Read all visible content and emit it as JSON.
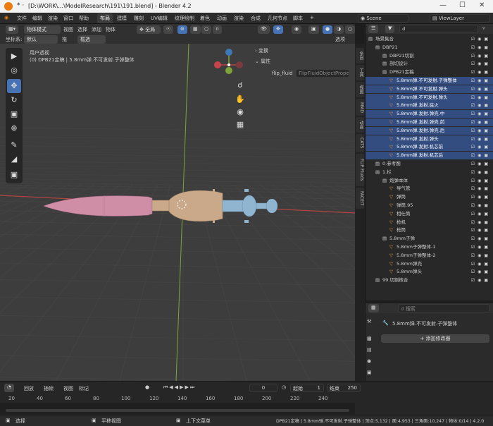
{
  "titlebar": {
    "title": "[D:\\WORK\\...\\ModelResearch\\191\\191.blend] - Blender 4.2"
  },
  "menubar": {
    "menus": [
      "文件",
      "编辑",
      "渲染",
      "窗口",
      "帮助"
    ],
    "workspaces": [
      "布局",
      "建模",
      "雕刻",
      "UV编辑",
      "纹理绘制",
      "着色",
      "动画",
      "渲染",
      "合成",
      "几何节点",
      "脚本"
    ],
    "scene": "Scene",
    "view_layer": "ViewLayer"
  },
  "vp_header": {
    "mode": "物体模式",
    "view": "视图",
    "select": "选择",
    "add": "添加",
    "object": "物体",
    "global": "全局",
    "coord_label": "坐标系:",
    "coord_value": "默认",
    "drag_label": "拖",
    "drag_value": "框选",
    "options": "选项"
  },
  "viewport": {
    "view_name": "用户透视",
    "info": "(0) DPB21定稿 | 5.8mm弹.不可发射.子弹整体",
    "panel_transform": "变换",
    "panel_props": "属性",
    "prop_key": "flip_fluid",
    "prop_value": "FlipFluidObjectProperti",
    "colors": {
      "bullet": "#cf8ea6",
      "case": "#c9a989",
      "fuse": "#8fb5d0",
      "grid": "#464646",
      "x_axis": "#b24444",
      "y_axis": "#7ea33a"
    }
  },
  "vtabs": [
    "条目",
    "工具",
    "视图",
    "MMD",
    "动画",
    "CATS",
    "FLIP Fluids",
    "FACEIT"
  ],
  "outliner": {
    "search_placeholder": "",
    "rows": [
      {
        "name": "场景集合",
        "indent": 0,
        "sel": false
      },
      {
        "name": "DBP21",
        "indent": 1,
        "sel": false
      },
      {
        "name": "DBP21切割",
        "indent": 2,
        "sel": false
      },
      {
        "name": "剖切设计",
        "indent": 2,
        "sel": false
      },
      {
        "name": "DPB21定稿",
        "indent": 2,
        "sel": false
      },
      {
        "name": "5.8mm弹.不可发射.子弹整体",
        "indent": 3,
        "sel": true
      },
      {
        "name": "5.8mm弹.不可发射.弹头",
        "indent": 3,
        "sel": true
      },
      {
        "name": "5.8mm弹.不可发射.弹头",
        "indent": 3,
        "sel": true
      },
      {
        "name": "5.8mm弹.发射.底火",
        "indent": 3,
        "sel": true
      },
      {
        "name": "5.8mm弹.发射.弹壳.中",
        "indent": 3,
        "sel": true
      },
      {
        "name": "5.8mm弹.发射.弹壳.前",
        "indent": 3,
        "sel": true
      },
      {
        "name": "5.8mm弹.发射.弹壳.后",
        "indent": 3,
        "sel": true
      },
      {
        "name": "5.8mm弹.发射.弹头",
        "indent": 3,
        "sel": true
      },
      {
        "name": "5.8mm弹.发射.机芯前",
        "indent": 3,
        "sel": true
      },
      {
        "name": "5.8mm弹.发射.机芯后",
        "indent": 3,
        "sel": true
      },
      {
        "name": "0.参考图",
        "indent": 1,
        "sel": false
      },
      {
        "name": "1.栏",
        "indent": 1,
        "sel": false
      },
      {
        "name": "炮弹本体",
        "indent": 2,
        "sel": false
      },
      {
        "name": "导气管",
        "indent": 3,
        "sel": false
      },
      {
        "name": "弹筒",
        "indent": 3,
        "sel": false
      },
      {
        "name": "弹筒.95",
        "indent": 3,
        "sel": false
      },
      {
        "name": "相仕筒",
        "indent": 3,
        "sel": false
      },
      {
        "name": "枪机",
        "indent": 3,
        "sel": false
      },
      {
        "name": "枪筒",
        "indent": 3,
        "sel": false
      },
      {
        "name": "5.8mm子弹",
        "indent": 2,
        "sel": false
      },
      {
        "name": "5.8mm子弹整体-1",
        "indent": 3,
        "sel": false
      },
      {
        "name": "5.8mm子弹整体-2",
        "indent": 3,
        "sel": false
      },
      {
        "name": "5.8mm弹壳",
        "indent": 3,
        "sel": false
      },
      {
        "name": "5.8mm弹头",
        "indent": 3,
        "sel": false
      },
      {
        "name": "99.切割核合",
        "indent": 1,
        "sel": false
      }
    ]
  },
  "props": {
    "search_placeholder": "搜索",
    "object_name": "5.8mm弹.不可发射.子弹整体",
    "add_modifier": "添加修改器"
  },
  "timeline": {
    "playback": "回放",
    "keying": "插帧",
    "view": "视图",
    "markers": "标记",
    "current_frame": "0",
    "start_label": "起始",
    "start": "1",
    "end_label": "结束",
    "end": "250",
    "ticks": [
      "20",
      "40",
      "60",
      "80",
      "100",
      "120",
      "140",
      "160",
      "180",
      "200",
      "220",
      "240"
    ]
  },
  "statusbar": {
    "select": "选择",
    "pan": "平移视图",
    "context": "上下文菜单",
    "stats": "DPB21定稿 | 5.8mm弹.不可发射.子弹整体 | 顶点:5,132 | 面:4,953 | 三角面:10,247 | 物体:0/14 | 4.2.0"
  }
}
